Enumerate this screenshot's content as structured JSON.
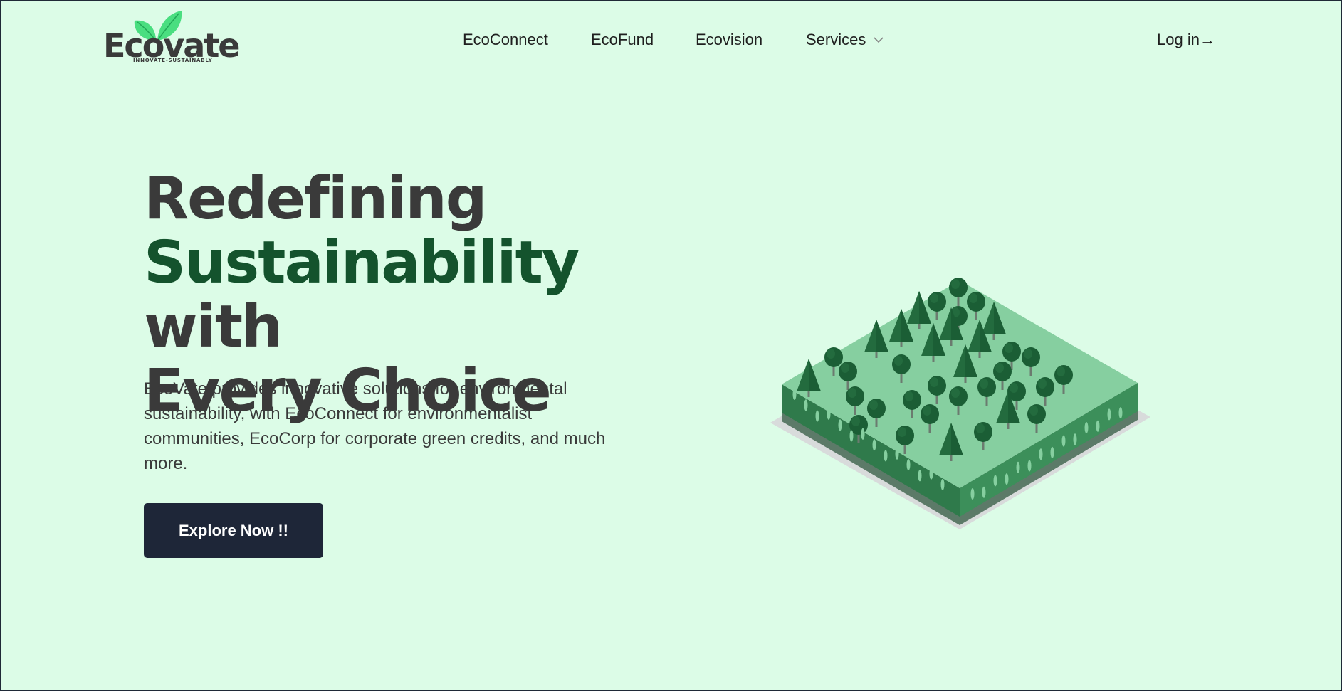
{
  "brand": {
    "name": "Ecovate",
    "tagline": "INNOVATE-SUSTAINABLY",
    "leaf_color": "#4ade80",
    "text_color": "#3a3a3a"
  },
  "nav": {
    "items": [
      {
        "label": "EcoConnect"
      },
      {
        "label": "EcoFund"
      },
      {
        "label": "Ecovision"
      },
      {
        "label": "Services"
      }
    ],
    "services_icon": "chevron-down-icon",
    "login_label": "Log in→"
  },
  "hero": {
    "title_line1": "Redefining",
    "title_accent": "Sustainability",
    "title_line2_rest": " with",
    "title_line3": "Every Choice",
    "description": "EcoVate provides innovative solutions for environmental sustainability, with EcoConnect for environmentalist communities, EcoCorp for corporate green credits, and much more.",
    "cta_label": "Explore Now !!"
  },
  "illustration": {
    "name": "isometric-forest-illustration",
    "colors": {
      "grass_top": "#86cfa0",
      "side_left": "#2f7a4b",
      "side_right": "#3c8f5a",
      "tree_dark": "#1b5e35",
      "tree_mid": "#236b3e",
      "base_shadow": "#d8dbdb"
    }
  },
  "colors": {
    "background": "#dcfce7",
    "accent_green": "#14532d",
    "button_bg": "#1e2638"
  }
}
